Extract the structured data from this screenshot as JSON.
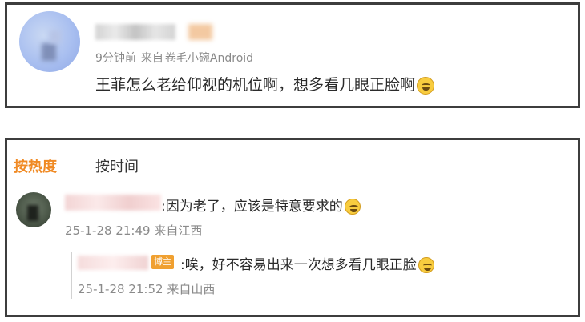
{
  "post": {
    "meta": {
      "time": "9分钟前",
      "source_prefix": "来自",
      "source": "卷毛小碗Android"
    },
    "text": "王菲怎么老给仰视的机位啊，想多看几眼正脸啊"
  },
  "comments_panel": {
    "tabs": [
      "按热度",
      "按时间"
    ],
    "comment": {
      "text": ":因为老了，应该是特意要求的",
      "date": "25-1-28 21:49",
      "location": "来自江西"
    },
    "reply": {
      "badge": "博主",
      "text": ":唉，好不容易出来一次想多看几眼正脸",
      "date": "25-1-28 21:52",
      "location": "来自山西"
    }
  },
  "colors": {
    "accent": "#f08a24",
    "badge_bg": "#f0a030",
    "meta_gray": "#8a8a8a",
    "border": "#3d3d3d"
  },
  "icons": [
    "emoji-sweat-smile-icon",
    "emoji-crying-icon"
  ]
}
